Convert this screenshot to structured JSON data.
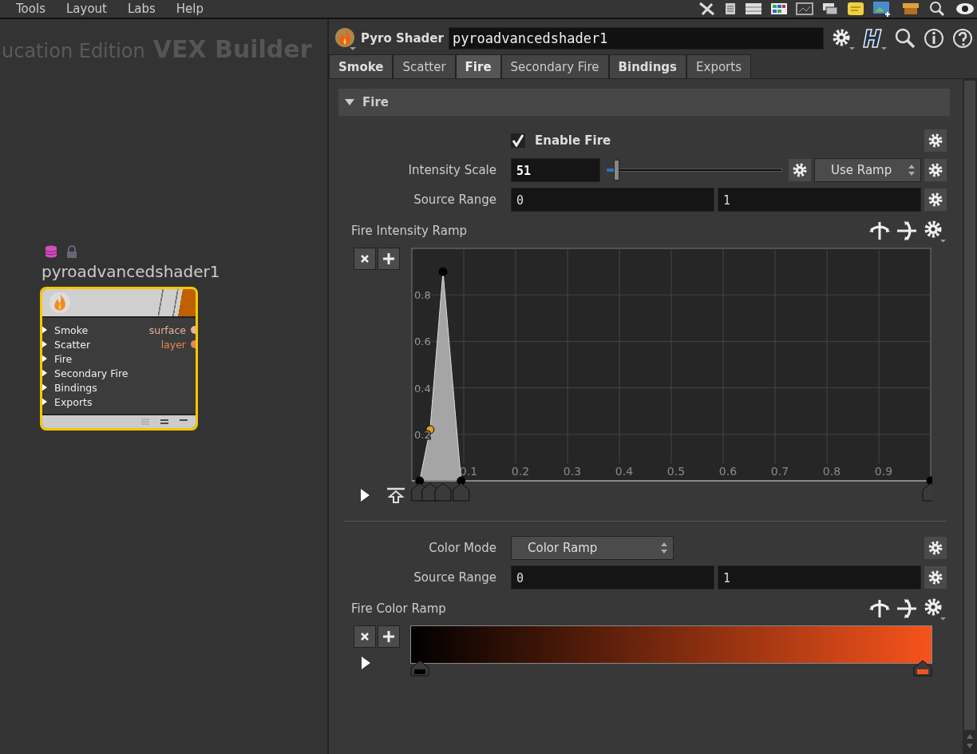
{
  "menu": [
    "Tools",
    "Layout",
    "Labs",
    "Help"
  ],
  "network": {
    "edition": "ucation Edition",
    "context": "VEX Builder",
    "node": {
      "name": "pyroadvancedshader1",
      "selected": true,
      "inputs": [
        "Smoke",
        "Scatter",
        "Fire",
        "Secondary Fire",
        "Bindings",
        "Exports"
      ],
      "outputs": [
        {
          "name": "surface",
          "color": "#e8b09a"
        },
        {
          "name": "layer",
          "color": "#e8884a"
        }
      ]
    }
  },
  "params": {
    "type": "Pyro Shader",
    "name": "pyroadvancedshader1",
    "tabs": [
      {
        "label": "Smoke",
        "modified": true,
        "selected": false
      },
      {
        "label": "Scatter",
        "modified": false,
        "selected": false
      },
      {
        "label": "Fire",
        "modified": true,
        "selected": true
      },
      {
        "label": "Secondary Fire",
        "modified": false,
        "selected": false
      },
      {
        "label": "Bindings",
        "modified": true,
        "selected": false
      },
      {
        "label": "Exports",
        "modified": false,
        "selected": false
      }
    ],
    "folder": {
      "label": "Fire",
      "expanded": true
    },
    "enable": {
      "label": "Enable Fire",
      "checked": true
    },
    "intensity": {
      "label": "Intensity Scale",
      "value": "51",
      "level": 0.06,
      "mode": "Use Ramp"
    },
    "source_range": {
      "label": "Source Range",
      "min": "0",
      "max": "1"
    },
    "intensity_ramp": {
      "label": "Fire Intensity Ramp",
      "keys": [
        {
          "selected": false
        },
        {
          "selected": true
        },
        {
          "selected": false
        },
        {
          "selected": false
        },
        {
          "selected": false
        }
      ],
      "chart_data": {
        "type": "area",
        "x": [
          0.015,
          0.035,
          0.06,
          0.095,
          1.0
        ],
        "series": [
          {
            "color": "#b4b4b4",
            "values": [
              0,
              0.22,
              0.9,
              0,
              0
            ]
          }
        ],
        "grid": true,
        "xlim": [
          0,
          1
        ],
        "ylim": [
          0,
          1
        ],
        "xticks": [
          0.1,
          0.2,
          0.3,
          0.4,
          0.5,
          0.6,
          0.7,
          0.8,
          0.9
        ],
        "yticks": [
          0.2,
          0.4,
          0.6,
          0.8
        ]
      }
    },
    "color_mode": {
      "label": "Color Mode",
      "value": "Color Ramp"
    },
    "color_source_range": {
      "label": "Source Range",
      "min": "0",
      "max": "1"
    },
    "color_ramp": {
      "label": "Fire Color Ramp",
      "keys": [
        {
          "color": "#000000"
        },
        {
          "color": "#f6531c"
        }
      ]
    }
  }
}
